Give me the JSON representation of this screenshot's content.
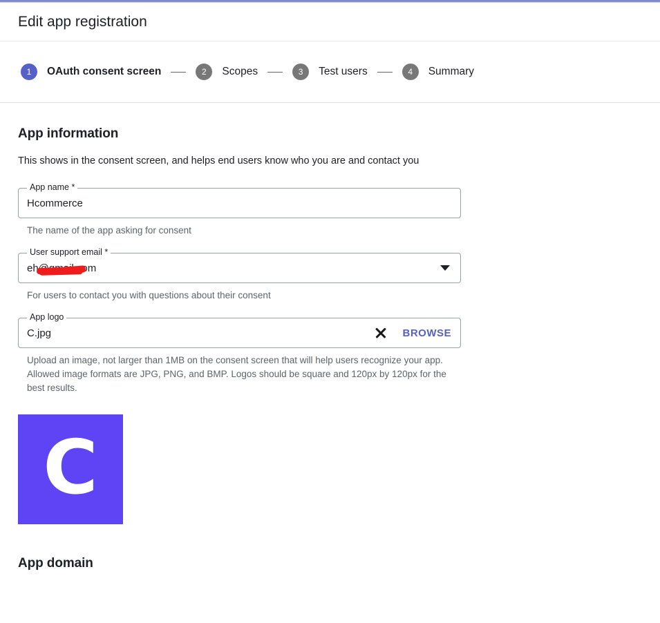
{
  "header": {
    "title": "Edit app registration"
  },
  "stepper": {
    "steps": [
      {
        "number": "1",
        "label": "OAuth consent screen",
        "state": "active"
      },
      {
        "number": "2",
        "label": "Scopes",
        "state": "inactive"
      },
      {
        "number": "3",
        "label": "Test users",
        "state": "inactive"
      },
      {
        "number": "4",
        "label": "Summary",
        "state": "inactive"
      }
    ]
  },
  "colors": {
    "active_step": "#5561c7",
    "inactive_step": "#787878",
    "link": "#5561c7",
    "logo_background": "#5f44f5",
    "redaction": "#ee1c1c"
  },
  "app_information": {
    "heading": "App information",
    "description": "This shows in the consent screen, and helps end users know who you are and contact you",
    "app_name": {
      "label": "App name *",
      "value": "Hcommerce",
      "helper": "The name of the app asking for consent"
    },
    "user_support_email": {
      "label": "User support email *",
      "value_prefix": "e",
      "value_suffix": "h@gmail.com",
      "helper": "For users to contact you with questions about their consent",
      "dropdown_icon": "chevron-down-icon"
    },
    "app_logo": {
      "label": "App logo",
      "value": "C.jpg",
      "clear_icon": "close-icon",
      "browse_label": "BROWSE",
      "helper": "Upload an image, not larger than 1MB on the consent screen that will help users recognize your app. Allowed image formats are JPG, PNG, and BMP. Logos should be square and 120px by 120px for the best results.",
      "preview_letter": "C"
    }
  },
  "app_domain": {
    "heading": "App domain"
  }
}
